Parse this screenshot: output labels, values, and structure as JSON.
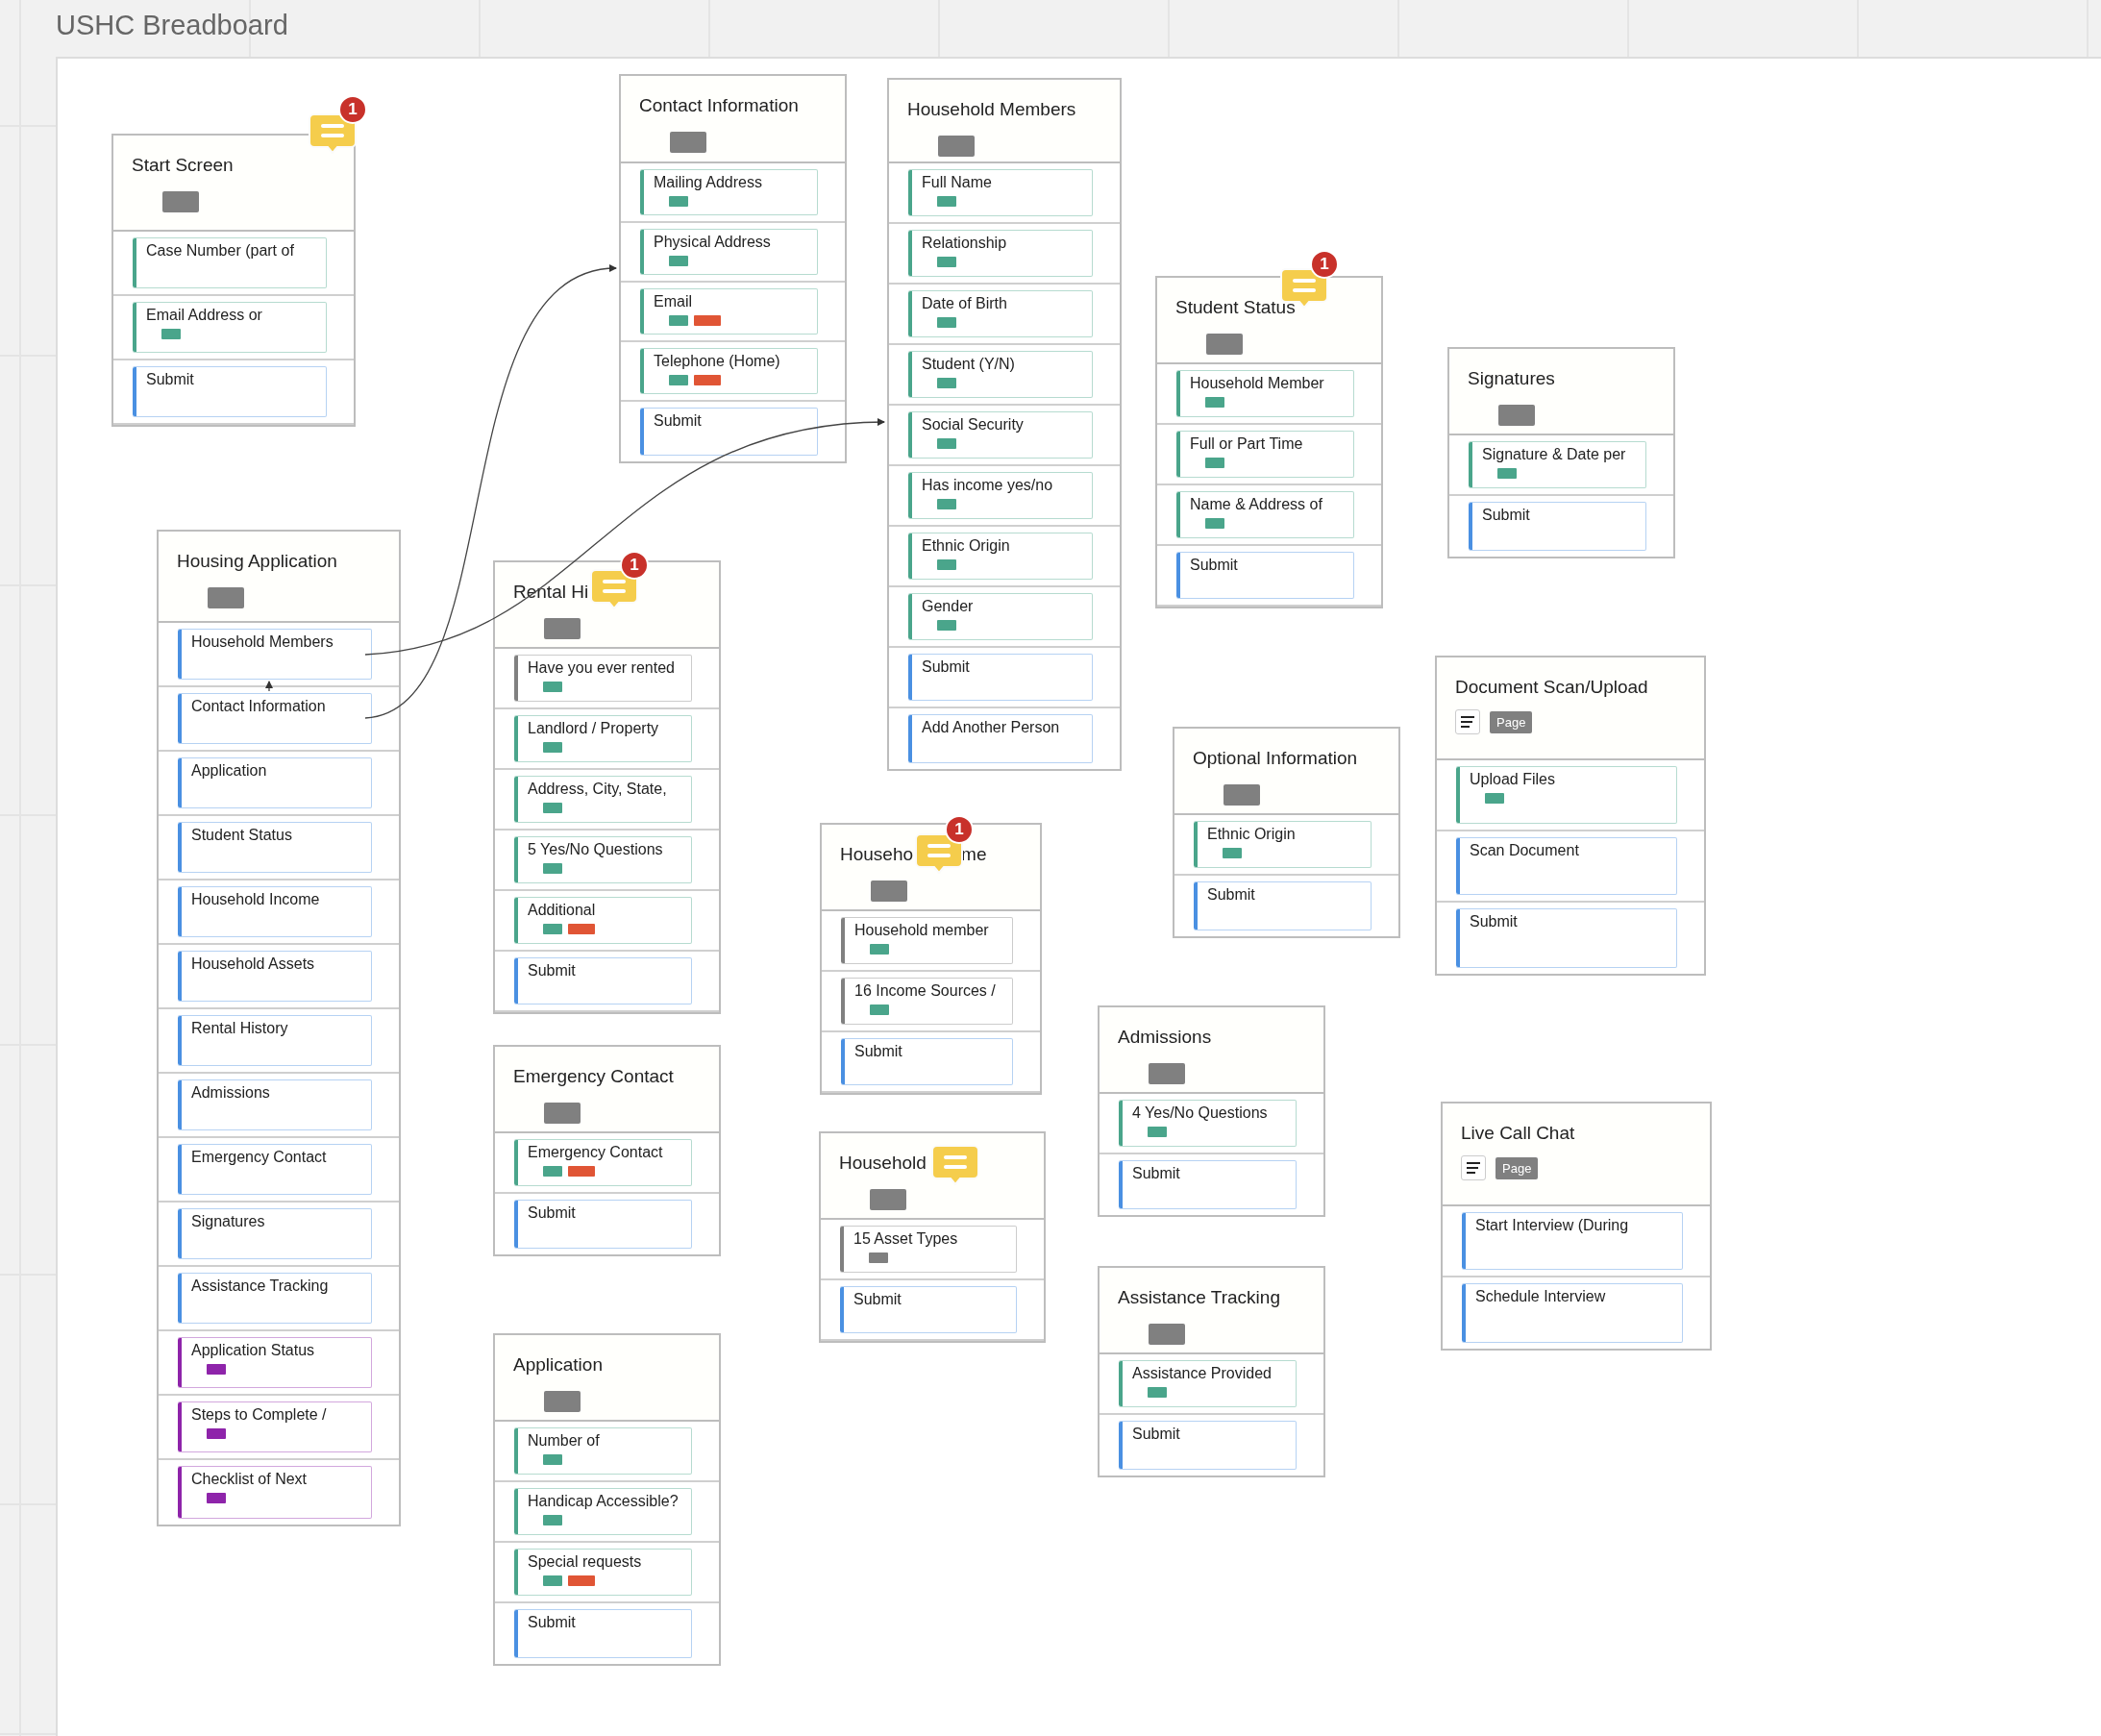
{
  "title": "USHC Breadboard",
  "cards": [
    {
      "title": "Start Screen",
      "kind": "screen",
      "comment": true,
      "comment_badge": "1",
      "rows": [
        {
          "label": "Case Number (part of",
          "color": "#4aa58b",
          "tags": []
        },
        {
          "label": "Email Address or",
          "color": "#4aa58b",
          "tags": [
            {
              "color": "#4aa58b"
            }
          ]
        },
        {
          "label": "Submit",
          "color": "#4a90e2",
          "tags": []
        }
      ]
    },
    {
      "title": "Contact Information",
      "kind": "screen",
      "rows": [
        {
          "label": "Mailing Address",
          "color": "#4aa58b",
          "tags": [
            {
              "color": "#4aa58b"
            }
          ]
        },
        {
          "label": "Physical Address",
          "color": "#4aa58b",
          "tags": [
            {
              "color": "#4aa58b"
            }
          ]
        },
        {
          "label": "Email",
          "color": "#4aa58b",
          "tags": [
            {
              "color": "#4aa58b"
            },
            {
              "color": "#e05535"
            }
          ]
        },
        {
          "label": "Telephone (Home)",
          "color": "#4aa58b",
          "tags": [
            {
              "color": "#4aa58b"
            },
            {
              "color": "#e05535"
            }
          ]
        },
        {
          "label": "Submit",
          "color": "#4a90e2",
          "tags": []
        }
      ]
    },
    {
      "title": "Household Members",
      "kind": "screen",
      "rows": [
        {
          "label": "Full Name",
          "color": "#4aa58b",
          "tags": [
            {
              "color": "#4aa58b"
            }
          ]
        },
        {
          "label": "Relationship",
          "color": "#4aa58b",
          "tags": [
            {
              "color": "#4aa58b"
            }
          ]
        },
        {
          "label": "Date of Birth",
          "color": "#4aa58b",
          "tags": [
            {
              "color": "#4aa58b"
            }
          ]
        },
        {
          "label": "Student (Y/N)",
          "color": "#4aa58b",
          "tags": [
            {
              "color": "#4aa58b"
            }
          ]
        },
        {
          "label": "Social Security",
          "color": "#4aa58b",
          "tags": [
            {
              "color": "#4aa58b"
            }
          ]
        },
        {
          "label": "Has income yes/no",
          "color": "#4aa58b",
          "tags": [
            {
              "color": "#4aa58b"
            }
          ]
        },
        {
          "label": "Ethnic Origin",
          "color": "#4aa58b",
          "tags": [
            {
              "color": "#4aa58b"
            }
          ]
        },
        {
          "label": "Gender",
          "color": "#4aa58b",
          "tags": [
            {
              "color": "#4aa58b"
            }
          ]
        },
        {
          "label": "Submit",
          "color": "#4a90e2",
          "tags": []
        },
        {
          "label": "Add Another Person",
          "color": "#4a90e2",
          "tags": []
        }
      ]
    },
    {
      "title": "Housing Application",
      "kind": "screen",
      "rows": [
        {
          "label": "Household Members",
          "color": "#4a90e2",
          "tags": []
        },
        {
          "label": "Contact Information",
          "color": "#4a90e2",
          "tags": []
        },
        {
          "label": "Application",
          "color": "#4a90e2",
          "tags": []
        },
        {
          "label": "Student Status",
          "color": "#4a90e2",
          "tags": []
        },
        {
          "label": "Household Income",
          "color": "#4a90e2",
          "tags": []
        },
        {
          "label": "Household Assets",
          "color": "#4a90e2",
          "tags": []
        },
        {
          "label": "Rental History",
          "color": "#4a90e2",
          "tags": []
        },
        {
          "label": "Admissions",
          "color": "#4a90e2",
          "tags": []
        },
        {
          "label": "Emergency Contact",
          "color": "#4a90e2",
          "tags": []
        },
        {
          "label": "Signatures",
          "color": "#4a90e2",
          "tags": []
        },
        {
          "label": "Assistance Tracking",
          "color": "#4a90e2",
          "tags": []
        },
        {
          "label": "Application Status",
          "color": "#8e24aa",
          "tags": [
            {
              "color": "#8e24aa"
            }
          ]
        },
        {
          "label": "Steps to Complete /",
          "color": "#8e24aa",
          "tags": [
            {
              "color": "#8e24aa"
            }
          ]
        },
        {
          "label": "Checklist of Next",
          "color": "#8e24aa",
          "tags": [
            {
              "color": "#8e24aa"
            }
          ]
        }
      ]
    },
    {
      "title": "Rental Hi",
      "kind": "screen",
      "comment": true,
      "comment_badge": "1",
      "rows": [
        {
          "label": "Have you ever rented",
          "color": "#808080",
          "tags": [
            {
              "color": "#4aa58b"
            }
          ]
        },
        {
          "label": "Landlord / Property",
          "color": "#4aa58b",
          "tags": [
            {
              "color": "#4aa58b"
            }
          ]
        },
        {
          "label": "Address, City, State,",
          "color": "#4aa58b",
          "tags": [
            {
              "color": "#4aa58b"
            }
          ]
        },
        {
          "label": "5 Yes/No Questions",
          "color": "#4aa58b",
          "tags": [
            {
              "color": "#4aa58b"
            }
          ]
        },
        {
          "label": "Additional",
          "color": "#4aa58b",
          "tags": [
            {
              "color": "#4aa58b"
            },
            {
              "color": "#e05535"
            }
          ]
        },
        {
          "label": "Submit",
          "color": "#4a90e2",
          "tags": []
        }
      ]
    },
    {
      "title": "Emergency Contact",
      "kind": "screen",
      "rows": [
        {
          "label": "Emergency Contact",
          "color": "#4aa58b",
          "tags": [
            {
              "color": "#4aa58b"
            },
            {
              "color": "#e05535"
            }
          ]
        },
        {
          "label": "Submit",
          "color": "#4a90e2",
          "tags": []
        }
      ]
    },
    {
      "title": "Application",
      "kind": "screen",
      "rows": [
        {
          "label": "Number of",
          "color": "#4aa58b",
          "tags": [
            {
              "color": "#4aa58b"
            }
          ]
        },
        {
          "label": "Handicap Accessible?",
          "color": "#4aa58b",
          "tags": [
            {
              "color": "#4aa58b"
            }
          ]
        },
        {
          "label": "Special requests",
          "color": "#4aa58b",
          "tags": [
            {
              "color": "#4aa58b"
            },
            {
              "color": "#e05535"
            }
          ]
        },
        {
          "label": "Submit",
          "color": "#4a90e2",
          "tags": []
        }
      ]
    },
    {
      "title": "Student Status",
      "kind": "screen",
      "comment": true,
      "comment_badge": "1",
      "rows": [
        {
          "label": "Household Member",
          "color": "#4aa58b",
          "tags": [
            {
              "color": "#4aa58b"
            }
          ]
        },
        {
          "label": "Full or Part Time",
          "color": "#4aa58b",
          "tags": [
            {
              "color": "#4aa58b"
            }
          ]
        },
        {
          "label": "Name & Address of",
          "color": "#4aa58b",
          "tags": [
            {
              "color": "#4aa58b"
            }
          ]
        },
        {
          "label": "Submit",
          "color": "#4a90e2",
          "tags": []
        }
      ]
    },
    {
      "title": "Signatures",
      "kind": "screen",
      "rows": [
        {
          "label": "Signature & Date per",
          "color": "#4aa58b",
          "tags": [
            {
              "color": "#4aa58b"
            }
          ]
        },
        {
          "label": "Submit",
          "color": "#4a90e2",
          "tags": []
        }
      ]
    },
    {
      "title": "Househo",
      "title_end": "me",
      "kind": "screen",
      "comment": true,
      "comment_badge": "1",
      "rows": [
        {
          "label": "Household member",
          "color": "#808080",
          "tags": [
            {
              "color": "#4aa58b"
            }
          ]
        },
        {
          "label": "16 Income Sources /",
          "color": "#808080",
          "tags": [
            {
              "color": "#4aa58b"
            }
          ]
        },
        {
          "label": "Submit",
          "color": "#4a90e2",
          "tags": []
        }
      ]
    },
    {
      "title": "Household",
      "kind": "screen",
      "comment": true,
      "rows": [
        {
          "label": "15 Asset Types",
          "color": "#808080",
          "tags": [
            {
              "color": "#808080"
            }
          ]
        },
        {
          "label": "Submit",
          "color": "#4a90e2",
          "tags": []
        }
      ]
    },
    {
      "title": "Optional Information",
      "kind": "screen",
      "rows": [
        {
          "label": "Ethnic Origin",
          "color": "#4aa58b",
          "tags": [
            {
              "color": "#4aa58b"
            }
          ]
        },
        {
          "label": "Submit",
          "color": "#4a90e2",
          "tags": []
        }
      ]
    },
    {
      "title": "Admissions",
      "kind": "screen",
      "rows": [
        {
          "label": "4 Yes/No Questions",
          "color": "#4aa58b",
          "tags": [
            {
              "color": "#4aa58b"
            }
          ]
        },
        {
          "label": "Submit",
          "color": "#4a90e2",
          "tags": []
        }
      ]
    },
    {
      "title": "Assistance Tracking",
      "kind": "screen",
      "rows": [
        {
          "label": "Assistance Provided",
          "color": "#4aa58b",
          "tags": [
            {
              "color": "#4aa58b"
            }
          ]
        },
        {
          "label": "Submit",
          "color": "#4a90e2",
          "tags": []
        }
      ]
    },
    {
      "title": "Document Scan/Upload",
      "kind": "page",
      "page_badge": "Page",
      "rows": [
        {
          "label": "Upload Files",
          "color": "#4aa58b",
          "tags": [
            {
              "color": "#4aa58b"
            }
          ]
        },
        {
          "label": "Scan Document",
          "color": "#4a90e2",
          "tags": []
        },
        {
          "label": "Submit",
          "color": "#4a90e2",
          "tags": []
        }
      ]
    },
    {
      "title": "Live Call Chat",
      "kind": "page",
      "page_badge": "Page",
      "rows": [
        {
          "label": "Start Interview (During",
          "color": "#4a90e2",
          "tags": []
        },
        {
          "label": "Schedule Interview",
          "color": "#4a90e2",
          "tags": []
        }
      ]
    }
  ]
}
